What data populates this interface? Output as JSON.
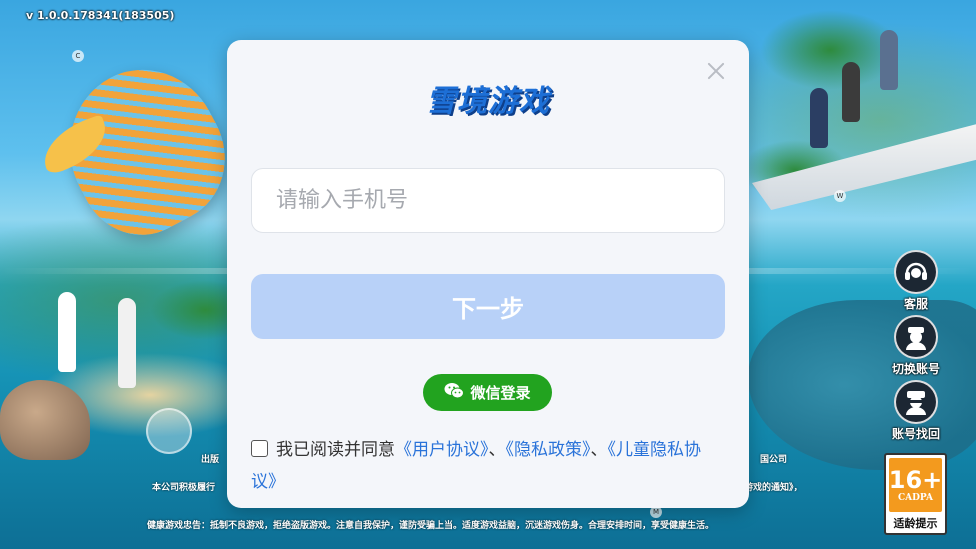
{
  "version": "v 1.0.0.178341(183505)",
  "dialog": {
    "logo": "雪境游戏",
    "phone_placeholder": "请输入手机号",
    "next_label": "下一步",
    "wechat_label": "微信登录",
    "agree_prefix": "我已阅读并同意",
    "user_agreement": "《用户协议》",
    "separator1": "、",
    "privacy_policy": "《隐私政策》",
    "separator2": "、",
    "child_privacy": "《儿童隐私协议》",
    "checked": false
  },
  "side_buttons": [
    {
      "label": "客服",
      "icon": "headset-icon"
    },
    {
      "label": "切换账号",
      "icon": "switch-account-icon"
    },
    {
      "label": "账号找回",
      "icon": "account-recovery-icon"
    }
  ],
  "age_rating": {
    "number": "16+",
    "org": "CADPA",
    "label": "适龄提示"
  },
  "footer": {
    "publisher_partial": "出版",
    "company_partial": "国公司",
    "notice_left": "本公司积极履行",
    "notice_right": "游戏的通知》，",
    "health_notice": "健康游戏忠告：抵制不良游戏，拒绝盗版游戏。注意自我保护，谨防受骗上当。适度游戏益脑，沉迷游戏伤身。合理安排时间，享受健康生活。"
  },
  "colors": {
    "primary_blue": "#2a73d9",
    "disabled_button": "#b8d1f8",
    "wechat_green": "#22a31f",
    "age_orange": "#f39a1e"
  }
}
